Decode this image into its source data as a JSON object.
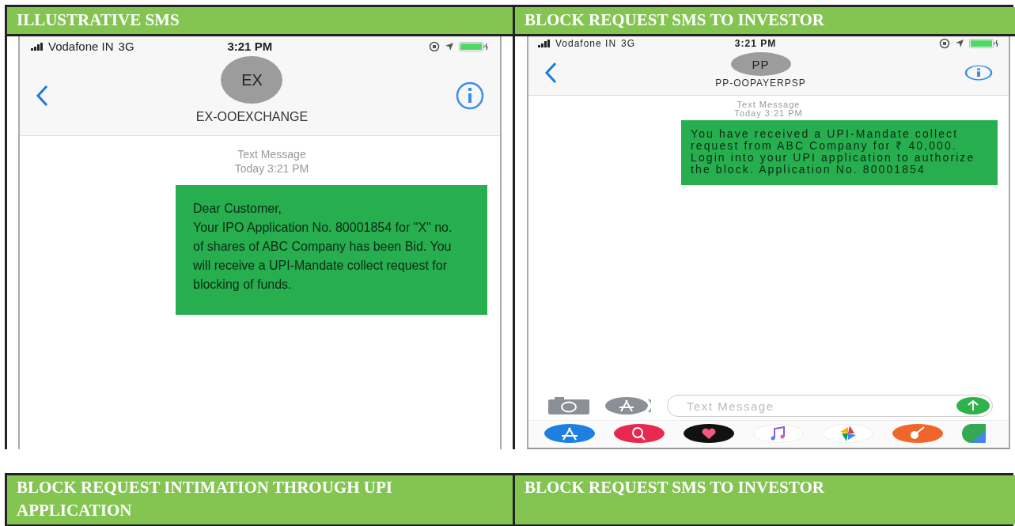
{
  "tables": [
    {
      "panels": [
        {
          "header": "ILLUSTRATIVE SMS",
          "phone": {
            "carrier": "Vodafone IN",
            "network": "3G",
            "time": "3:21 PM",
            "initials": "EX",
            "sender": "EX-OOEXCHANGE",
            "meta_label": "Text Message",
            "meta_time": "Today 3:21 PM",
            "message": "Dear Customer,\nYour IPO Application No. 80001854 for \"X\" no. of shares of ABC Company has been Bid. You will receive a UPI-Mandate collect request for blocking of funds."
          }
        },
        {
          "header": "BLOCK REQUEST SMS TO INVESTOR",
          "phone": {
            "carrier": "Vodafone IN",
            "network": "3G",
            "time": "3:21 PM",
            "initials": "PP",
            "sender": "PP-OOPAYERPSP",
            "meta_label": "Text Message",
            "meta_time": "Today 3:21 PM",
            "message": "You have received a UPI-Mandate collect request from ABC Company for ₹ 40,000. Login into your UPI application to authorize the block. Application No. 80001854",
            "composer": {
              "placeholder": "Text Message"
            }
          }
        }
      ]
    },
    {
      "panels": [
        {
          "header": "BLOCK REQUEST INTIMATION THROUGH UPI APPLICATION"
        },
        {
          "header": "BLOCK REQUEST SMS TO INVESTOR"
        }
      ]
    }
  ]
}
